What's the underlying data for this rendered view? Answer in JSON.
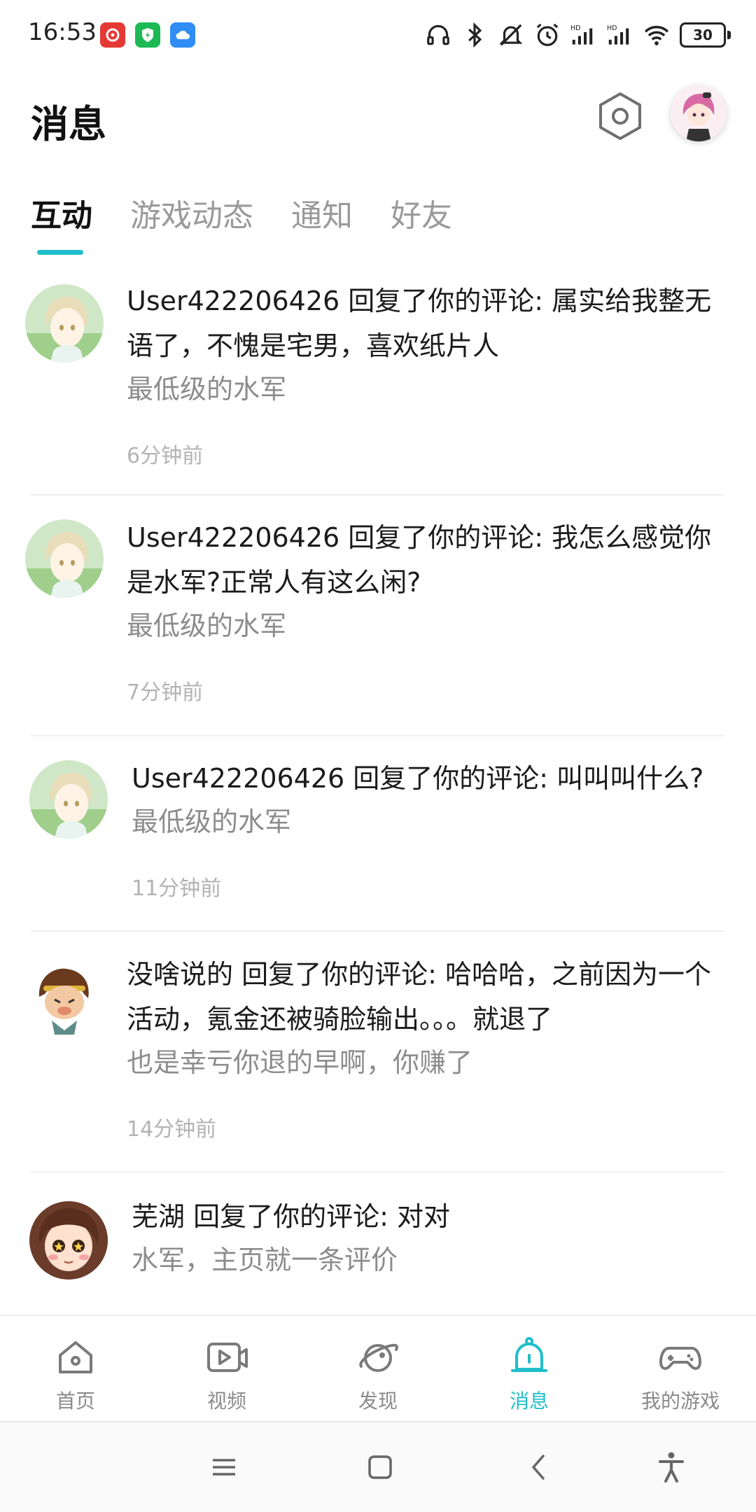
{
  "status_bar": {
    "time": "16:53",
    "app_icons": [
      "netease-music-icon",
      "shield-app-icon",
      "cloud-app-icon"
    ],
    "system_icons": [
      "headset-icon",
      "bluetooth-icon",
      "mute-icon",
      "alarm-icon",
      "signal-hd-icon",
      "signal-hd-icon",
      "wifi-icon"
    ],
    "battery": "30"
  },
  "header": {
    "title": "消息"
  },
  "tabs": [
    {
      "label": "互动",
      "active": true
    },
    {
      "label": "游戏动态",
      "active": false
    },
    {
      "label": "通知",
      "active": false
    },
    {
      "label": "好友",
      "active": false
    }
  ],
  "messages": [
    {
      "title": "User422206426 回复了你的评论: 属实给我整无语了，不愧是宅男，喜欢纸片人",
      "reply": "最低级的水军",
      "time": "6分钟前",
      "avatar": "anime-boy-avatar"
    },
    {
      "title": "User422206426 回复了你的评论: 我怎么感觉你是水军?正常人有这么闲?",
      "reply": "最低级的水军",
      "time": "7分钟前",
      "avatar": "anime-boy-avatar"
    },
    {
      "title": "User422206426 回复了你的评论: 叫叫叫什么?",
      "reply": "最低级的水军",
      "time": "11分钟前",
      "avatar": "anime-boy-avatar"
    },
    {
      "title": "没啥说的 回复了你的评论: 哈哈哈，之前因为一个活动，氪金还被骑脸输出。。。就退了",
      "reply": "也是幸亏你退的早啊，你赚了",
      "time": "14分钟前",
      "avatar": "monkey-king-avatar"
    },
    {
      "title": "芜湖 回复了你的评论: 对对",
      "reply": "水军，主页就一条评价",
      "time": "",
      "avatar": "girl-avatar"
    }
  ],
  "bottom_nav": [
    {
      "label": "首页",
      "icon": "home-icon",
      "active": false
    },
    {
      "label": "视频",
      "icon": "video-icon",
      "active": false
    },
    {
      "label": "发现",
      "icon": "discover-icon",
      "active": false
    },
    {
      "label": "消息",
      "icon": "bell-icon",
      "active": true
    },
    {
      "label": "我的游戏",
      "icon": "gamepad-icon",
      "active": false
    }
  ],
  "colors": {
    "accent": "#1fbecb",
    "text_primary": "#1b1b1b",
    "text_secondary": "#8c8c8c",
    "text_time": "#b3b3b3"
  }
}
